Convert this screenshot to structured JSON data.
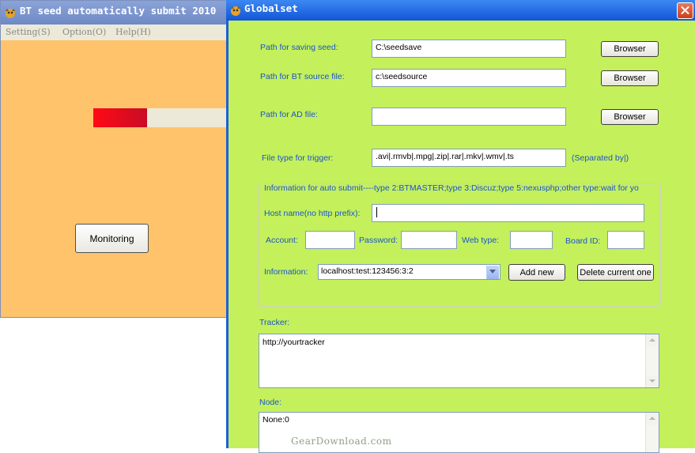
{
  "main_window": {
    "title": "BT seed automatically submit 2010",
    "menu": [
      "Setting(S)",
      "Option(O)",
      "Help(H)"
    ],
    "progress_fraction": 0.4,
    "monitoring_label": "Monitoring"
  },
  "dialog": {
    "title": "Globalset",
    "save_path": {
      "label": "Path for saving seed:",
      "value": "C:\\seedsave",
      "browse": "Browser"
    },
    "source_path": {
      "label": "Path for BT source file:",
      "value": "c:\\seedsource",
      "browse": "Browser"
    },
    "ad_path": {
      "label": "Path for AD file:",
      "value": "",
      "browse": "Browser"
    },
    "file_type": {
      "label": "File type for trigger:",
      "value": ".avi|.rmvb|.mpg|.zip|.rar|.mkv|.wmv|.ts",
      "hint": "(Separated by|)"
    },
    "group": {
      "caption": "Information for auto submit----type 2:BTMASTER;type 3:Discuz;type 5:nexusphp;other type:wait for yo",
      "host_label": "Host name(no http prefix):",
      "host_value": "",
      "account_label": "Account:",
      "password_label": "Password:",
      "web_type_label": "Web type:",
      "board_id_label": "Board ID:",
      "information_label": "Information:",
      "information_value": "localhost:test:123456:3:2",
      "add_new": "Add new",
      "delete_current": "Delete current one"
    },
    "tracker": {
      "label": "Tracker:",
      "value": "http://yourtracker"
    },
    "node": {
      "label": "Node:",
      "value": "None:0"
    }
  },
  "watermark": "GearDownload.com",
  "colors": {
    "dialog_bg": "#c4f05c",
    "main_bg": "#ffc46b",
    "label": "#1a54cc",
    "progress": "#e8061e"
  }
}
